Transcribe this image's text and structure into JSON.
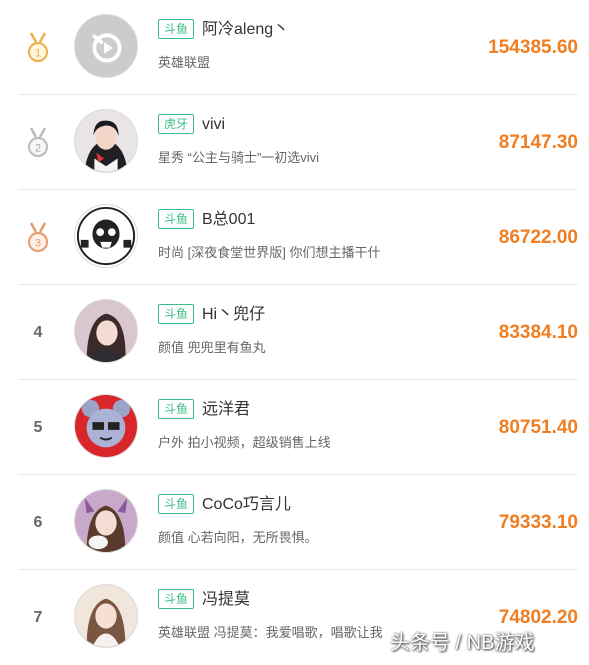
{
  "ranking": [
    {
      "rank": "1",
      "platform": "斗鱼",
      "name": "阿冷aleng丶",
      "description": "英雄联盟",
      "amount": "154385.60",
      "medal": "gold",
      "avatar": "play-logo"
    },
    {
      "rank": "2",
      "platform": "虎牙",
      "name": "vivi",
      "description": "星秀 “公主与骑士”一初选vivi",
      "amount": "87147.30",
      "medal": "silver",
      "avatar": "photo"
    },
    {
      "rank": "3",
      "platform": "斗鱼",
      "name": "B总001",
      "description": "时尚 [深夜食堂世界版] 你们想主播干什",
      "amount": "86722.00",
      "medal": "bronze",
      "avatar": "skull-logo"
    },
    {
      "rank": "4",
      "platform": "斗鱼",
      "name": "Hi丶兜仔",
      "description": "颜值 兜兜里有鱼丸",
      "amount": "83384.10",
      "medal": "",
      "avatar": "photo"
    },
    {
      "rank": "5",
      "platform": "斗鱼",
      "name": "远洋君",
      "description": "户外 拍小视频，超级销售上线",
      "amount": "80751.40",
      "medal": "",
      "avatar": "cartoon"
    },
    {
      "rank": "6",
      "platform": "斗鱼",
      "name": "CoCo巧言儿",
      "description": "颜值 心若向阳，无所畏惧。",
      "amount": "79333.10",
      "medal": "",
      "avatar": "photo"
    },
    {
      "rank": "7",
      "platform": "斗鱼",
      "name": "冯提莫",
      "description": "英雄联盟 冯提莫：我爱唱歌，唱歌让我",
      "amount": "74802.20",
      "medal": "",
      "avatar": "photo"
    }
  ],
  "watermark": "头条号 / NB游戏",
  "colors": {
    "amount": "#ef7d21",
    "platform_tag": "#3dbd86",
    "gold": "#e8b04a",
    "silver": "#bbbbbb",
    "bronze": "#e89a6c"
  }
}
